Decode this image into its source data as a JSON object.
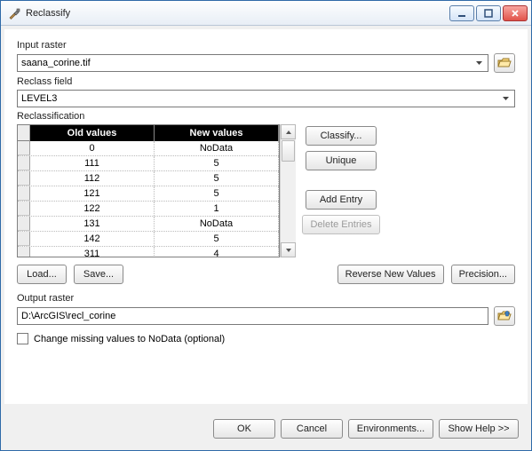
{
  "window": {
    "title": "Reclassify"
  },
  "labels": {
    "input_raster": "Input raster",
    "reclass_field": "Reclass field",
    "reclassification": "Reclassification",
    "output_raster": "Output raster",
    "change_missing": "Change missing values to NoData (optional)"
  },
  "fields": {
    "input_raster_value": "saana_corine.tif",
    "reclass_field_value": "LEVEL3",
    "output_raster_value": "D:\\ArcGIS\\recl_corine"
  },
  "table": {
    "headers": {
      "old": "Old values",
      "new": "New values"
    },
    "rows": [
      {
        "old": "0",
        "new": "NoData"
      },
      {
        "old": "111",
        "new": "5"
      },
      {
        "old": "112",
        "new": "5"
      },
      {
        "old": "121",
        "new": "5"
      },
      {
        "old": "122",
        "new": "1"
      },
      {
        "old": "131",
        "new": "NoData"
      },
      {
        "old": "142",
        "new": "5"
      },
      {
        "old": "311",
        "new": "4"
      }
    ]
  },
  "buttons": {
    "classify": "Classify...",
    "unique": "Unique",
    "add_entry": "Add Entry",
    "delete_entries": "Delete Entries",
    "load": "Load...",
    "save": "Save...",
    "reverse": "Reverse New Values",
    "precision": "Precision...",
    "ok": "OK",
    "cancel": "Cancel",
    "environments": "Environments...",
    "show_help": "Show Help >>"
  }
}
